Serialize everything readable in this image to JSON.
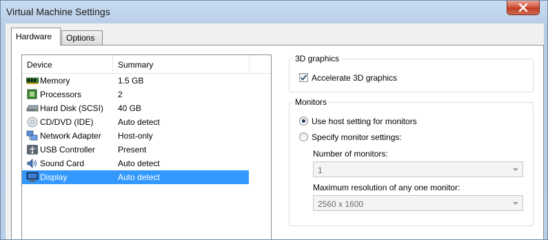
{
  "window": {
    "title": "Virtual Machine Settings"
  },
  "tabs": [
    {
      "label": "Hardware",
      "active": true
    },
    {
      "label": "Options",
      "active": false
    }
  ],
  "device_list": {
    "columns": {
      "device": "Device",
      "summary": "Summary"
    },
    "rows": [
      {
        "device": "Memory",
        "summary": "1.5 GB",
        "icon": "memory-icon"
      },
      {
        "device": "Processors",
        "summary": "2",
        "icon": "processor-icon"
      },
      {
        "device": "Hard Disk (SCSI)",
        "summary": "40 GB",
        "icon": "hard-disk-icon"
      },
      {
        "device": "CD/DVD (IDE)",
        "summary": "Auto detect",
        "icon": "cd-dvd-icon"
      },
      {
        "device": "Network Adapter",
        "summary": "Host-only",
        "icon": "network-adapter-icon"
      },
      {
        "device": "USB Controller",
        "summary": "Present",
        "icon": "usb-controller-icon"
      },
      {
        "device": "Sound Card",
        "summary": "Auto detect",
        "icon": "sound-card-icon"
      },
      {
        "device": "Display",
        "summary": "Auto detect",
        "icon": "display-icon",
        "selected": true
      }
    ]
  },
  "graphics_group": {
    "label": "3D graphics",
    "accelerate_label": "Accelerate 3D graphics",
    "accelerate_checked": true
  },
  "monitors_group": {
    "label": "Monitors",
    "use_host_label": "Use host setting for monitors",
    "use_host_selected": true,
    "specify_label": "Specify monitor settings:",
    "specify_selected": false,
    "num_monitors_label": "Number of monitors:",
    "num_monitors_value": "1",
    "max_res_label": "Maximum resolution of any one monitor:",
    "max_res_value": "2560 x 1600"
  },
  "colors": {
    "selection": "#3399ff",
    "title_bar": "#c9dcf0",
    "close_button": "#c23b22"
  }
}
